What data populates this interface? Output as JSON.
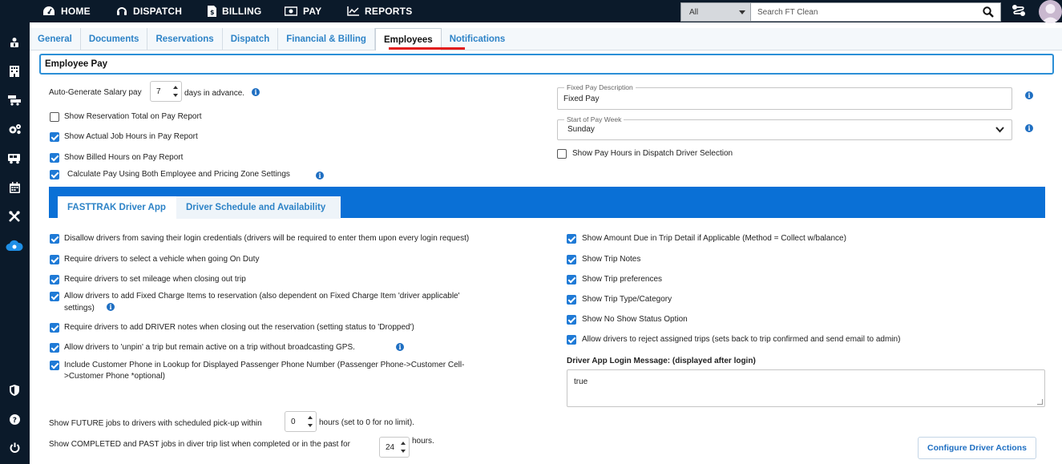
{
  "nav": {
    "home": "HOME",
    "dispatch": "DISPATCH",
    "billing": "BILLING",
    "pay": "PAY",
    "reports": "REPORTS"
  },
  "search": {
    "scope": "All",
    "placeholder": "Search FT Clean"
  },
  "tabs": [
    "General",
    "Documents",
    "Reservations",
    "Dispatch",
    "Financial & Billing",
    "Employees",
    "Notifications"
  ],
  "active_tab": "Employees",
  "section_title": "Employee Pay",
  "pay": {
    "auto_generate_label": "Auto-Generate Salary pay",
    "auto_generate_value": "7",
    "auto_generate_suffix": "days in advance.",
    "show_reservation_total": "Show Reservation Total on Pay Report",
    "show_actual_job_hours": "Show Actual Job Hours in Pay Report",
    "show_billed_hours": "Show Billed Hours on Pay Report",
    "calculate_pay_both": "Calculate Pay Using Both Employee and Pricing Zone Settings",
    "fixed_pay_desc_label": "Fixed Pay Description",
    "fixed_pay_desc_value": "Fixed Pay",
    "start_of_pay_week_label": "Start of Pay Week",
    "start_of_pay_week_value": "Sunday",
    "show_pay_hours_dispatch": "Show Pay Hours in Dispatch Driver Selection"
  },
  "subtabs": [
    "FASTTRAK Driver App",
    "Driver Schedule and Availability"
  ],
  "driver_left": [
    "Disallow drivers from saving their login credentials (drivers will be required to enter them upon every login request)",
    "Require drivers to select a vehicle when going On Duty",
    "Require drivers to set mileage when closing out trip",
    "Allow drivers to add Fixed Charge Items to reservation (also dependent on Fixed Charge Item 'driver applicable'",
    "settings)",
    "Require drivers to add DRIVER notes when closing out the reservation (setting status to 'Dropped')",
    "Allow drivers to 'unpin' a trip but remain active on a trip without broadcasting GPS.",
    "Include Customer Phone in Lookup for Displayed Passenger Phone Number (Passenger Phone->Customer Cell-",
    ">Customer Phone *optional)"
  ],
  "driver_right": [
    "Show Amount Due in Trip Detail if Applicable (Method = Collect w/balance)",
    "Show Trip Notes",
    "Show Trip preferences",
    "Show Trip Type/Category",
    "Show No Show Status Option",
    "Allow drivers to reject assigned trips (sets back to trip confirmed and send email to admin)"
  ],
  "login_message_label": "Driver App Login Message: (displayed after login)",
  "login_message_value": "true",
  "future_jobs": {
    "prefix": "Show FUTURE jobs to drivers with scheduled pick-up within",
    "value": "0",
    "suffix": "hours (set to 0 for no limit)."
  },
  "completed_jobs": {
    "prefix": "Show COMPLETED and PAST jobs in diver trip list when completed or in the past for",
    "value": "24",
    "suffix": "hours."
  },
  "configure_button": "Configure Driver Actions",
  "colors": {
    "nav_bg": "#0b1a2a",
    "accent_blue": "#0a70d6",
    "tab_text": "#2d83c7",
    "active_underline": "#e21b1b"
  }
}
